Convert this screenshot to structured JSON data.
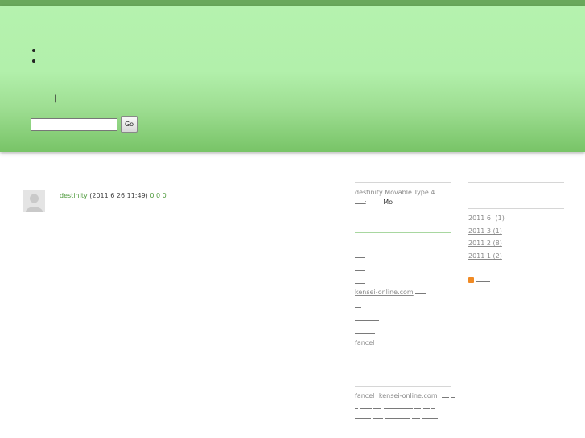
{
  "nav": {
    "items": [
      "",
      ""
    ],
    "separator": "|"
  },
  "search": {
    "value": "",
    "placeholder": "",
    "button_label": "Go"
  },
  "entry": {
    "author": "destinity",
    "datetime": "(2011 6 26  11:49)",
    "link1": "0",
    "link2": "0",
    "link3": "0"
  },
  "sidebar1": {
    "profile_text": "destinity   Movable Type 4",
    "profile_label_suffix": ":",
    "profile_value": "Mo",
    "link_kensei": "kensei-online.com",
    "link_fancel": "fancel",
    "footer_prefix": "fancel",
    "footer_link": "kensei-online.com"
  },
  "sidebar2": {
    "archives": [
      {
        "label": "2011 6",
        "count": "(1)"
      },
      {
        "label": "2011 3",
        "count": "(1)"
      },
      {
        "label": "2011 2",
        "count": "(8)"
      },
      {
        "label": "2011 1",
        "count": "(2)"
      }
    ]
  },
  "colors": {
    "header_top": "#b5f2ae",
    "header_bottom": "#78c467",
    "topbar": "#6aa85c",
    "link": "#4e9a3c"
  },
  "icons": [
    "rss-icon",
    "avatar-placeholder-icon"
  ]
}
